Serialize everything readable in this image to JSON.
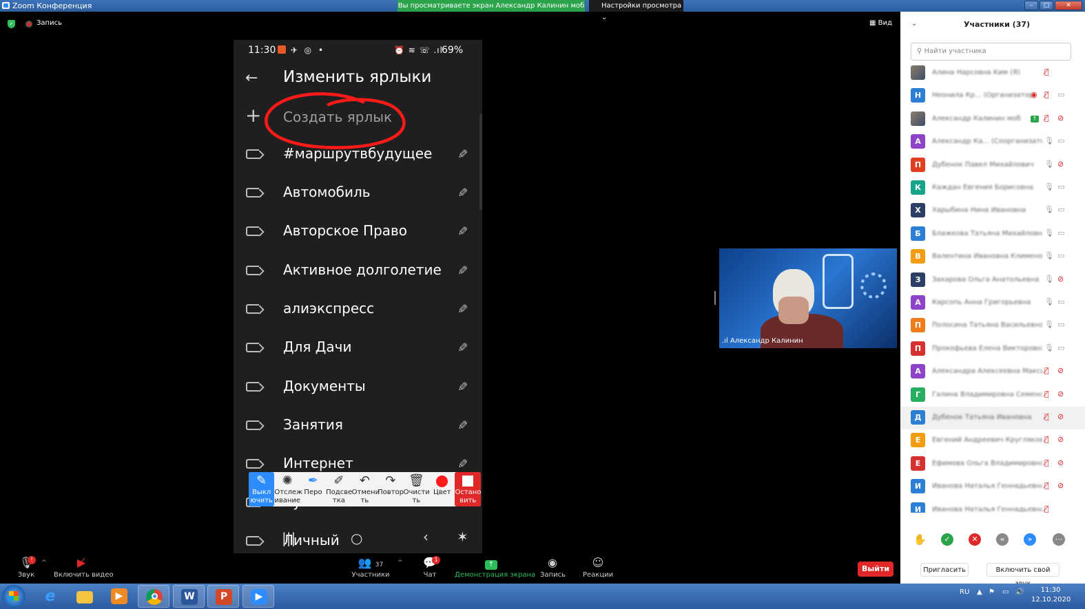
{
  "window": {
    "title": "Zoom Конференция",
    "share_banner": "Вы просматриваете экран Александр Калинин моб",
    "view_settings": "Настройки просмотра",
    "controls": [
      "–",
      "□",
      "✕"
    ]
  },
  "meeting": {
    "recording_label": "Запись",
    "view_label": "Вид"
  },
  "phone": {
    "time": "11:30",
    "battery": "69%",
    "title": "Изменить ярлыки",
    "create_label": "Создать ярлык",
    "labels": [
      "#маршрутвбудущее",
      "Автомобиль",
      "Авторское Право",
      "Активное долголетие",
      "алиэкспресс",
      "Для Дачи",
      "Документы",
      "Занятия",
      "Интернет",
      "Купить",
      "Личный"
    ],
    "nav": [
      "|||",
      "○",
      "‹"
    ]
  },
  "annotation_toolbar": {
    "tools": [
      {
        "label": "Выкл ючить",
        "icon": "pencil-icon",
        "active": true
      },
      {
        "label": "Отслеж ивание",
        "icon": "spotlight-icon"
      },
      {
        "label": "Перо",
        "icon": "pen-icon"
      },
      {
        "label": "Подсве тка",
        "icon": "highlighter-icon"
      },
      {
        "label": "Отмени ть",
        "icon": "undo-icon"
      },
      {
        "label": "Повтор",
        "icon": "redo-icon"
      },
      {
        "label": "Очисти ть",
        "icon": "trash-icon"
      },
      {
        "label": "Цвет",
        "icon": "color-icon"
      },
      {
        "label": "Остано вить",
        "icon": "stop-icon",
        "stop": true
      }
    ]
  },
  "video": {
    "name": "Александр Калинин"
  },
  "participants": {
    "title": "Участники (37)",
    "search_placeholder": "Найти участника",
    "list": [
      {
        "initial": "",
        "photo": true,
        "name": "Алина Нарсовна Ким (Я)",
        "color": "",
        "mic": "muted",
        "cam": "none"
      },
      {
        "initial": "Н",
        "name": "Неонила Кр... (Организатор)",
        "color": "#2d7fd6",
        "mic": "muted",
        "cam": "on",
        "rec": true
      },
      {
        "initial": "",
        "photo": true,
        "name": "Александр Калинин моб",
        "color": "",
        "mic": "muted",
        "cam": "off",
        "share": true
      },
      {
        "initial": "А",
        "name": "Александр Ка... (Соорганизатор)",
        "color": "#8e44c9",
        "mic": "on",
        "cam": "on"
      },
      {
        "initial": "П",
        "name": "Дубенок Павел Михайлович",
        "color": "#e0401f",
        "mic": "on",
        "cam": "off"
      },
      {
        "initial": "К",
        "name": "Каждан Евгения Борисовна",
        "color": "#17a589",
        "mic": "on",
        "cam": "on"
      },
      {
        "initial": "Х",
        "name": "Харыбина Нина Ивановна",
        "color": "#2c3e63",
        "mic": "on",
        "cam": "on"
      },
      {
        "initial": "Б",
        "name": "Блажкова Татьяна Михайловна",
        "color": "#2d7fd6",
        "mic": "on",
        "cam": "on"
      },
      {
        "initial": "В",
        "name": "Валентина Ивановна Климено...",
        "color": "#f39c12",
        "mic": "on",
        "cam": "on"
      },
      {
        "initial": "З",
        "name": "Захарова Ольга Анатольевна",
        "color": "#2c3e63",
        "mic": "on",
        "cam": "off"
      },
      {
        "initial": "А",
        "name": "Карсопь Анна Григорьевна",
        "color": "#8e44c9",
        "mic": "on",
        "cam": "on"
      },
      {
        "initial": "П",
        "name": "Полосина Татьяна Васильевна",
        "color": "#f07d1a",
        "mic": "on",
        "cam": "on"
      },
      {
        "initial": "П",
        "name": "Прокофьева Елена Викторовна",
        "color": "#d63031",
        "mic": "on",
        "cam": "on"
      },
      {
        "initial": "А",
        "name": "Александра Алексеевна Макси...",
        "color": "#8e44c9",
        "mic": "muted",
        "cam": "off"
      },
      {
        "initial": "Г",
        "name": "Галина Владимировна Семено...",
        "color": "#27ae60",
        "mic": "muted",
        "cam": "off"
      },
      {
        "initial": "Д",
        "name": "Дубенок Татьяна Ивановна",
        "color": "#2d7fd6",
        "mic": "muted",
        "cam": "off",
        "highlight": true
      },
      {
        "initial": "Е",
        "name": "Евгений Андреевич Кругляков",
        "color": "#f39c12",
        "mic": "muted",
        "cam": "off"
      },
      {
        "initial": "Е",
        "name": "Ефимова Ольга Владимировна",
        "color": "#d63031",
        "mic": "muted",
        "cam": "off"
      },
      {
        "initial": "И",
        "name": "Иванова Наталья Геннадьевна",
        "color": "#2d7fd6",
        "mic": "muted",
        "cam": "off"
      },
      {
        "initial": "И",
        "name": "Иванова Наталья Геннадьевна",
        "color": "#2d7fd6",
        "mic": "muted",
        "cam": "none"
      }
    ],
    "invite_label": "Пригласить",
    "unmute_label": "Включить свой звук"
  },
  "toolbar": {
    "audio_label": "Звук",
    "video_label": "Включить видео",
    "participants_label": "Участники",
    "participants_count": "37",
    "chat_label": "Чат",
    "chat_badge": "1",
    "share_label": "Демонстрация экрана",
    "record_label": "Запись",
    "reactions_label": "Реакции",
    "leave_label": "Выйти"
  },
  "taskbar": {
    "lang": "RU",
    "time": "11:30",
    "date": "12.10.2020",
    "apps": [
      "ie-icon",
      "explorer-icon",
      "media-icon",
      "chrome-icon",
      "word-icon",
      "powerpoint-icon",
      "zoom-icon"
    ]
  },
  "colors": {
    "accent": "#2d8cff",
    "danger": "#e02828",
    "success": "#2aa34a"
  }
}
